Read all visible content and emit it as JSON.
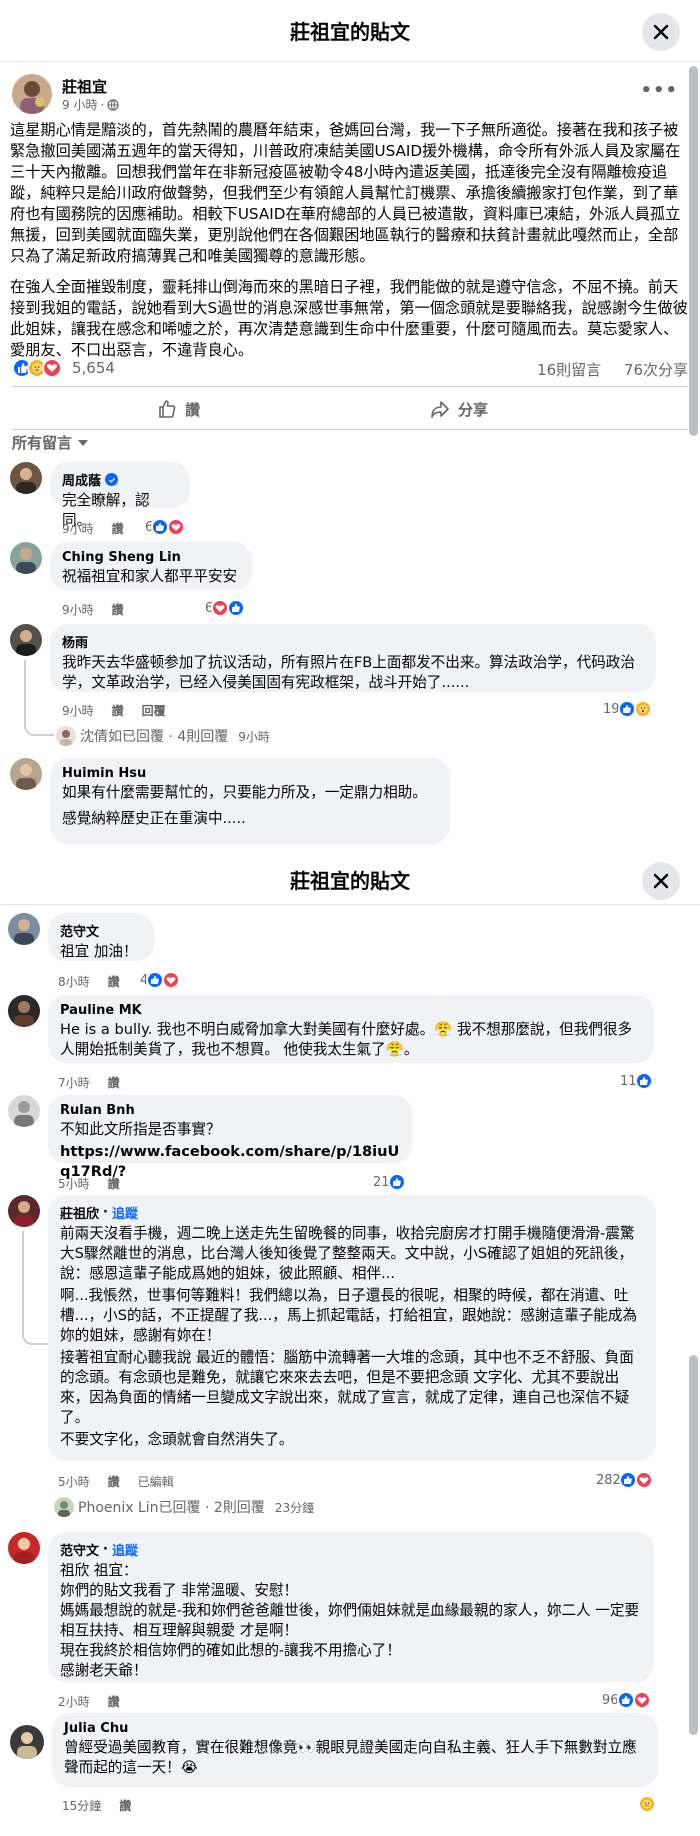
{
  "modal": {
    "title": "莊祖宜的貼文"
  },
  "post": {
    "author": "莊祖宜",
    "time": "9 小時",
    "paragraphs": [
      "這星期心情是黯淡的，首先熱鬧的農曆年結束，爸媽回台灣，我一下子無所適從。接著在我和孩子被緊急撤回美國滿五週年的當天得知，川普政府凍結美國USAID援外機構，命令所有外派人員及家屬在三十天內撤離。回想我們當年在非新冠疫區被勒令48小時內遣返美國，抵達後完全沒有隔離檢疫追蹤，純粹只是給川政府做聲勢，但我們至少有領館人員幫忙訂機票、承擔後續搬家打包作業，到了華府也有國務院的因應補助。相較下USAID在華府總部的人員已被遣散，資料庫已凍結，外派人員孤立無援，回到美國就面臨失業，更別說他們在各個艱困地區執行的醫療和扶貧計畫就此嘎然而止，全部只為了滿足新政府搞薄異己和唯美國獨尊的意識形態。",
      "在強人全面摧毀制度，靈耗排山倒海而來的黑暗日子裡，我們能做的就是遵守信念，不屈不撓。前天接到我姐的電話，說她看到大S過世的消息深感世事無常，第一個念頭就是要聯絡我，說感謝今生做彼此姐妹，讓我在感念和唏噓之於，再次清楚意識到生命中什麼重要，什麼可隨風而去。莫忘愛家人、愛朋友、不口出惡言，不違背良心。"
    ],
    "reactions_count": "5,654",
    "comments_count": "16則留言",
    "shares_count": "76次分享",
    "like_label": "讚",
    "share_label": "分享",
    "filter_label": "所有留言"
  },
  "comments": [
    {
      "name": "周成蔭",
      "text": "完全瞭解，認同。",
      "time": "9小時",
      "like": "讚",
      "count": "6"
    },
    {
      "name": "Ching Sheng Lin",
      "text": "祝福祖宜和家人都平平安安",
      "time": "9小時",
      "like": "讚",
      "count": "6"
    },
    {
      "name": "杨雨",
      "text": "我昨天去华盛顿参加了抗议活动，所有照片在FB上面都发不出来。算法政治学，代码政治学，文革政治学，已经入侵美国固有宪政框架，战斗开始了......",
      "time": "9小時",
      "like": "讚",
      "reply": "回覆",
      "count": "19",
      "reply_summary": "沈倩如已回覆 · 4則回覆",
      "reply_time": "9小時"
    },
    {
      "name": "Huimin Hsu",
      "text": "如果有什麼需要幫忙的，只要能力所及，一定鼎力相助。",
      "text2": "感覺納粹歷史正在重演中.....",
      "time": "",
      "like": ""
    },
    {
      "name": "范守文",
      "text": "祖宜 加油！",
      "time": "8小時",
      "like": "讚",
      "count": "4"
    },
    {
      "name": "Pauline MK",
      "text": "He is a bully. 我也不明白威脅加拿大對美國有什麼好處。😤 我不想那麼說，但我們很多人開始抵制美貨了，我也不想買。 他使我太生氣了😤。",
      "time": "7小時",
      "like": "讚",
      "count": "11"
    },
    {
      "name": "Rulan Bnh",
      "text": "不知此文所指是否事實？",
      "link": "https://www.facebook.com/share/p/18iuUq17Rd/?",
      "time": "5小時",
      "like": "讚",
      "count": "21"
    },
    {
      "name": "莊祖欣",
      "follow": "追蹤",
      "text": "前兩天沒看手機，週二晚上送走先生留晚餐的同事，收拾完廚房才打開手機隨便滑滑-震驚大S驟然離世的消息，比台灣人後知後覺了整整兩天。文中說，小S確認了姐姐的死訊後，說：感恩這輩子能成爲她的姐妹，彼此照顧、相伴...",
      "text2": "啊...我悵然，世事何等難料！我們總以為，日子還長的很呢，相聚的時候，都在消遣、吐槽...，小S的話，不正提醒了我...，馬上抓起電話，打給祖宜，跟她說：感謝這輩子能成為妳的姐妹，感謝有妳在！",
      "text3": "接著祖宜耐心聽我說 最近的體悟：腦筋中流轉著一大堆的念頭，其中也不乏不舒服、負面的念頭。有念頭也是難免，就讓它來來去去吧，但是不要把念頭 文字化、尤其不要說出來，因為負面的情緒一旦變成文字說出來，就成了宣言，就成了定律，連自己也深信不疑了。",
      "text4": "不要文字化，念頭就會自然消失了。",
      "time": "5小時",
      "like": "讚",
      "edited": "已編輯",
      "count": "282",
      "reply_summary": "Phoenix Lin已回覆 · 2則回覆",
      "reply_time": "23分鐘"
    },
    {
      "name": "范守文",
      "follow": "追蹤",
      "text": "祖欣 祖宜：",
      "text2": "妳們的貼文我看了 非常溫暖、安慰！",
      "text3": "媽媽最想說的就是-我和妳們爸爸離世後，妳們倆姐妹就是血緣最親的家人，妳二人 一定要 相互扶持、相互理解與親愛 才是啊！",
      "text4": "現在我終於相信妳們的確如此想的-讓我不用擔心了！",
      "text5": "感謝老天爺！",
      "time": "2小時",
      "like": "讚",
      "count": "96"
    },
    {
      "name": "Julia Chu",
      "text": "曾經受過美國教育，實在很難想像竟👀親眼見證美國走向自私主義、狂人手下無數對立應聲而起的這一天！😭",
      "time": "15分鐘",
      "like": "讚"
    }
  ],
  "colors": {
    "like": "#0866ff",
    "love": "#f33e58",
    "care": "#f7b125",
    "text_secondary": "#65676b"
  }
}
